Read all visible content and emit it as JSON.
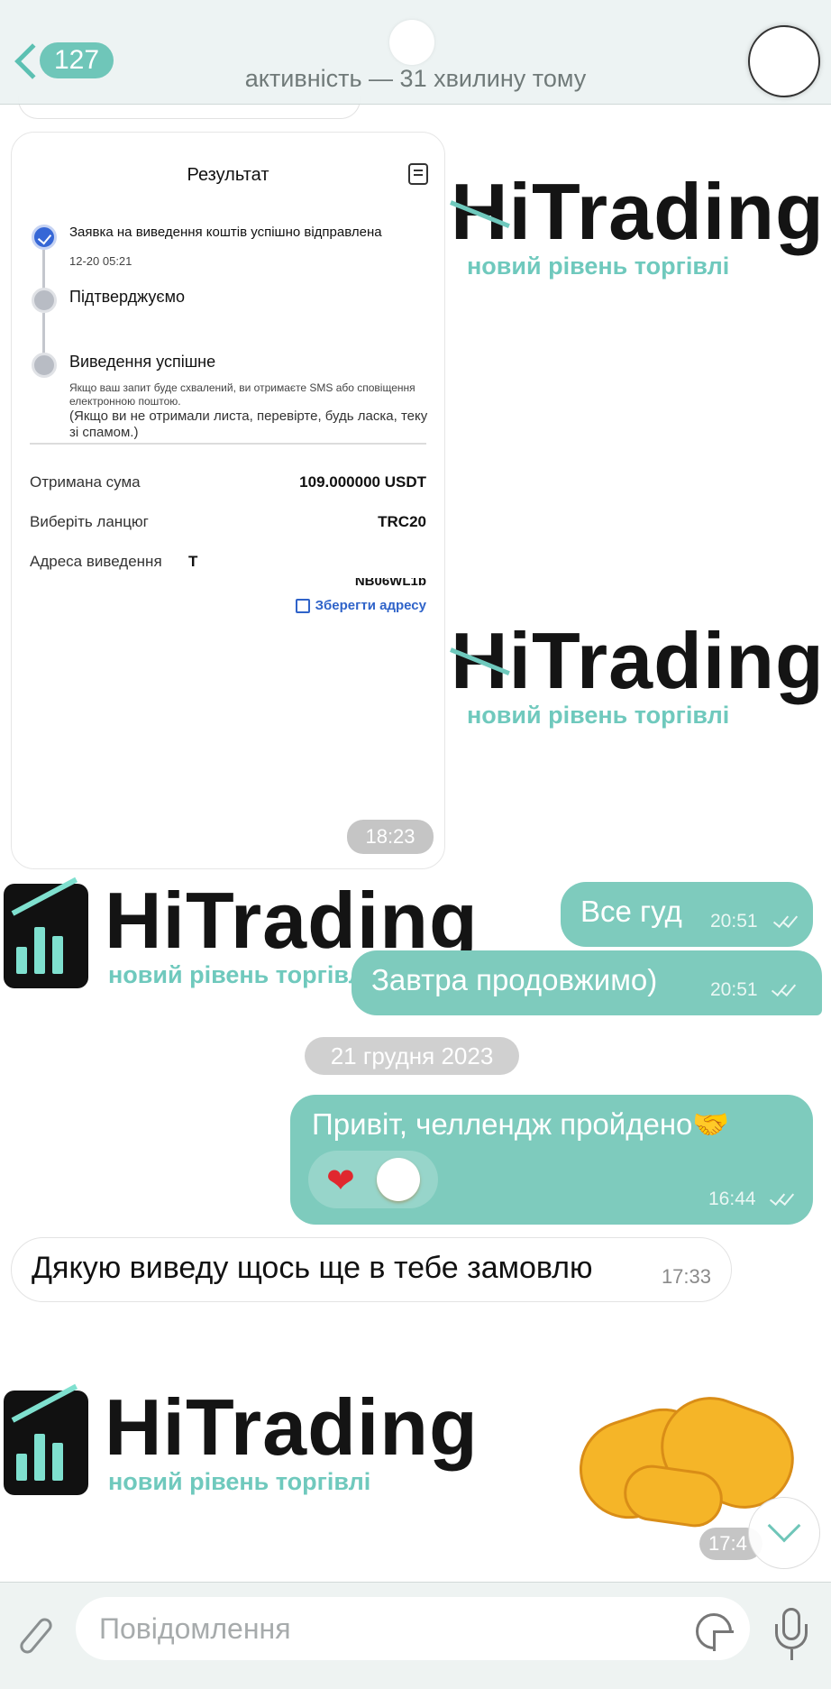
{
  "header": {
    "unread_count": "127",
    "status": "активність — 31 хвилину тому"
  },
  "wallpaper": {
    "brand": "HiTrading",
    "tagline": "новий рівень торгівлі"
  },
  "screenshot_message": {
    "title": "Результат",
    "step1_label": "Заявка на виведення коштів успішно відправлена",
    "step1_time": "12-20 05:21",
    "step2_label": "Підтверджуємо",
    "step3_label": "Виведення успішне",
    "step3_note_small": "Якщо ваш запит буде схвалений, ви отримаєте SMS або сповіщення електронною поштою.",
    "step3_note": "(Якщо ви не отримали листа, перевірте, будь ласка, теку зі спамом.)",
    "amount_label": "Отримана сума",
    "amount_value": "109.000000 USDT",
    "chain_label": "Виберіть ланцюг",
    "chain_value": "TRC20",
    "address_label": "Адреса виведення",
    "address_value": "T",
    "address_cut": "NB06WL1p",
    "save_address": "Зберегти адресу",
    "time": "18:23"
  },
  "messages": [
    {
      "text": "Все гуд",
      "time": "20:51"
    },
    {
      "text": "Завтра продовжимо)",
      "time": "20:51"
    },
    {
      "text": "Привіт, челлендж пройдено🤝",
      "time": "16:44",
      "reaction": "❤"
    },
    {
      "text": "Дякую виведу щось ще в тебе замовлю",
      "time": "17:33"
    }
  ],
  "date_separator": "21 грудня 2023",
  "sticker_time": "17:4",
  "input": {
    "placeholder": "Повідомлення"
  },
  "colors": {
    "accent": "#6fc6b9",
    "outgoing_bubble": "#7ecbbd",
    "step_done": "#3667d6",
    "link": "#2f63c9"
  },
  "icons": [
    "back-chevron-icon",
    "document-icon",
    "check-icon",
    "save-icon",
    "heart-icon",
    "chevron-down-icon",
    "paperclip-icon",
    "sticker-icon",
    "microphone-icon"
  ]
}
